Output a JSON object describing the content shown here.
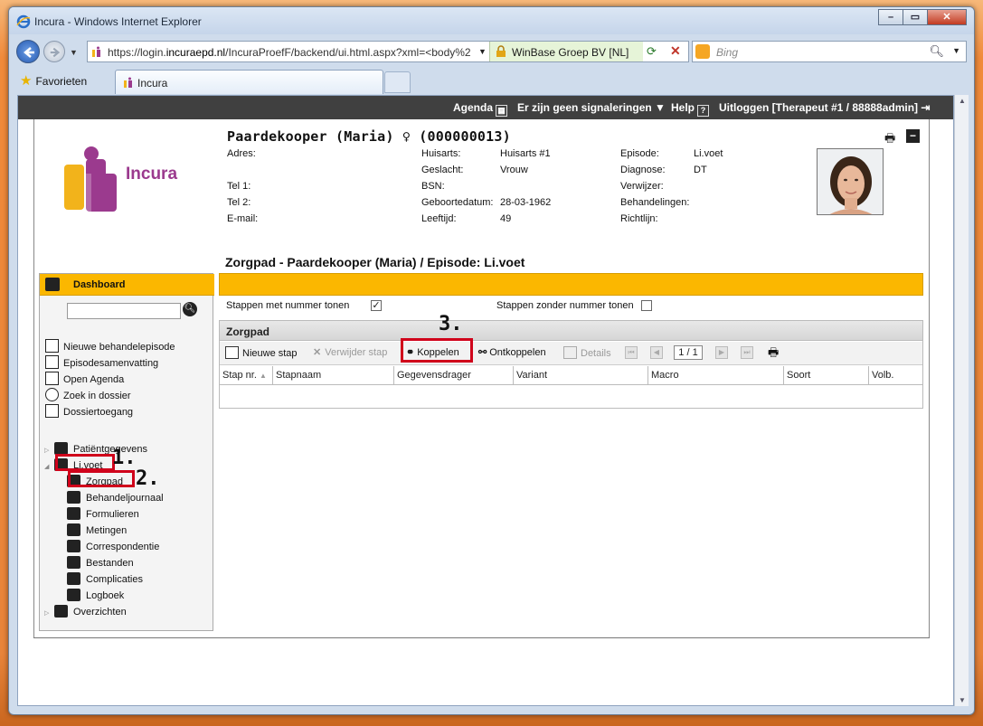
{
  "browser": {
    "title": "Incura - Windows Internet Explorer",
    "url_prefix": "https://login.",
    "url_domain": "incuraepd.nl",
    "url_rest": "/IncuraProefF/backend/ui.html.aspx?xml=<body%2",
    "security_label": "WinBase Groep BV [NL]",
    "search_placeholder": "Bing",
    "favorites_label": "Favorieten",
    "tab_label": "Incura"
  },
  "topbar": {
    "agenda": "Agenda",
    "signals": "Er zijn geen signaleringen",
    "help": "Help",
    "logout": "Uitloggen [Therapeut #1 / 88888admin]"
  },
  "brand": {
    "name": "Incura"
  },
  "patient": {
    "name": "Paardekooper (Maria) ♀ (000000013)",
    "labels": {
      "adres": "Adres:",
      "tel1": "Tel 1:",
      "tel2": "Tel 2:",
      "email": "E-mail:",
      "huisarts": "Huisarts:",
      "geslacht": "Geslacht:",
      "bsn": "BSN:",
      "geboortedatum": "Geboortedatum:",
      "leeftijd": "Leeftijd:",
      "episode": "Episode:",
      "diagnose": "Diagnose:",
      "verwijzer": "Verwijzer:",
      "behandelingen": "Behandelingen:",
      "richtlijn": "Richtlijn:"
    },
    "values": {
      "huisarts": "Huisarts #1",
      "geslacht": "Vrouw",
      "geboortedatum": "28-03-1962",
      "leeftijd": "49",
      "episode": "Li.voet",
      "diagnose": "DT"
    }
  },
  "section_title": "Zorgpad - Paardekooper (Maria) / Episode: Li.voet",
  "sidebar": {
    "dashboard": "Dashboard",
    "menu": [
      "Nieuwe behandelepisode",
      "Episodesamenvatting",
      "Open Agenda",
      "Zoek in dossier",
      "Dossiertoegang"
    ],
    "tree": {
      "patient": "Patiëntgegevens",
      "episode": "Li.voet",
      "children": [
        "Zorgpad",
        "Behandeljournaal",
        "Formulieren",
        "Metingen",
        "Correspondentie",
        "Bestanden",
        "Complicaties",
        "Logboek"
      ],
      "overzichten": "Overzichten"
    }
  },
  "annotations": [
    "1.",
    "2.",
    "3."
  ],
  "options": {
    "with_number": "Stappen met nummer tonen",
    "with_number_checked": true,
    "without_number": "Stappen zonder nummer tonen",
    "without_number_checked": false
  },
  "grid": {
    "title": "Zorgpad",
    "toolbar": {
      "new_step": "Nieuwe stap",
      "delete_step": "Verwijder stap",
      "link": "Koppelen",
      "unlink": "Ontkoppelen",
      "details": "Details",
      "page": "1 / 1"
    },
    "columns": [
      "Stap nr.",
      "Stapnaam",
      "Gegevensdrager",
      "Variant",
      "Macro",
      "Soort",
      "Volb."
    ]
  }
}
